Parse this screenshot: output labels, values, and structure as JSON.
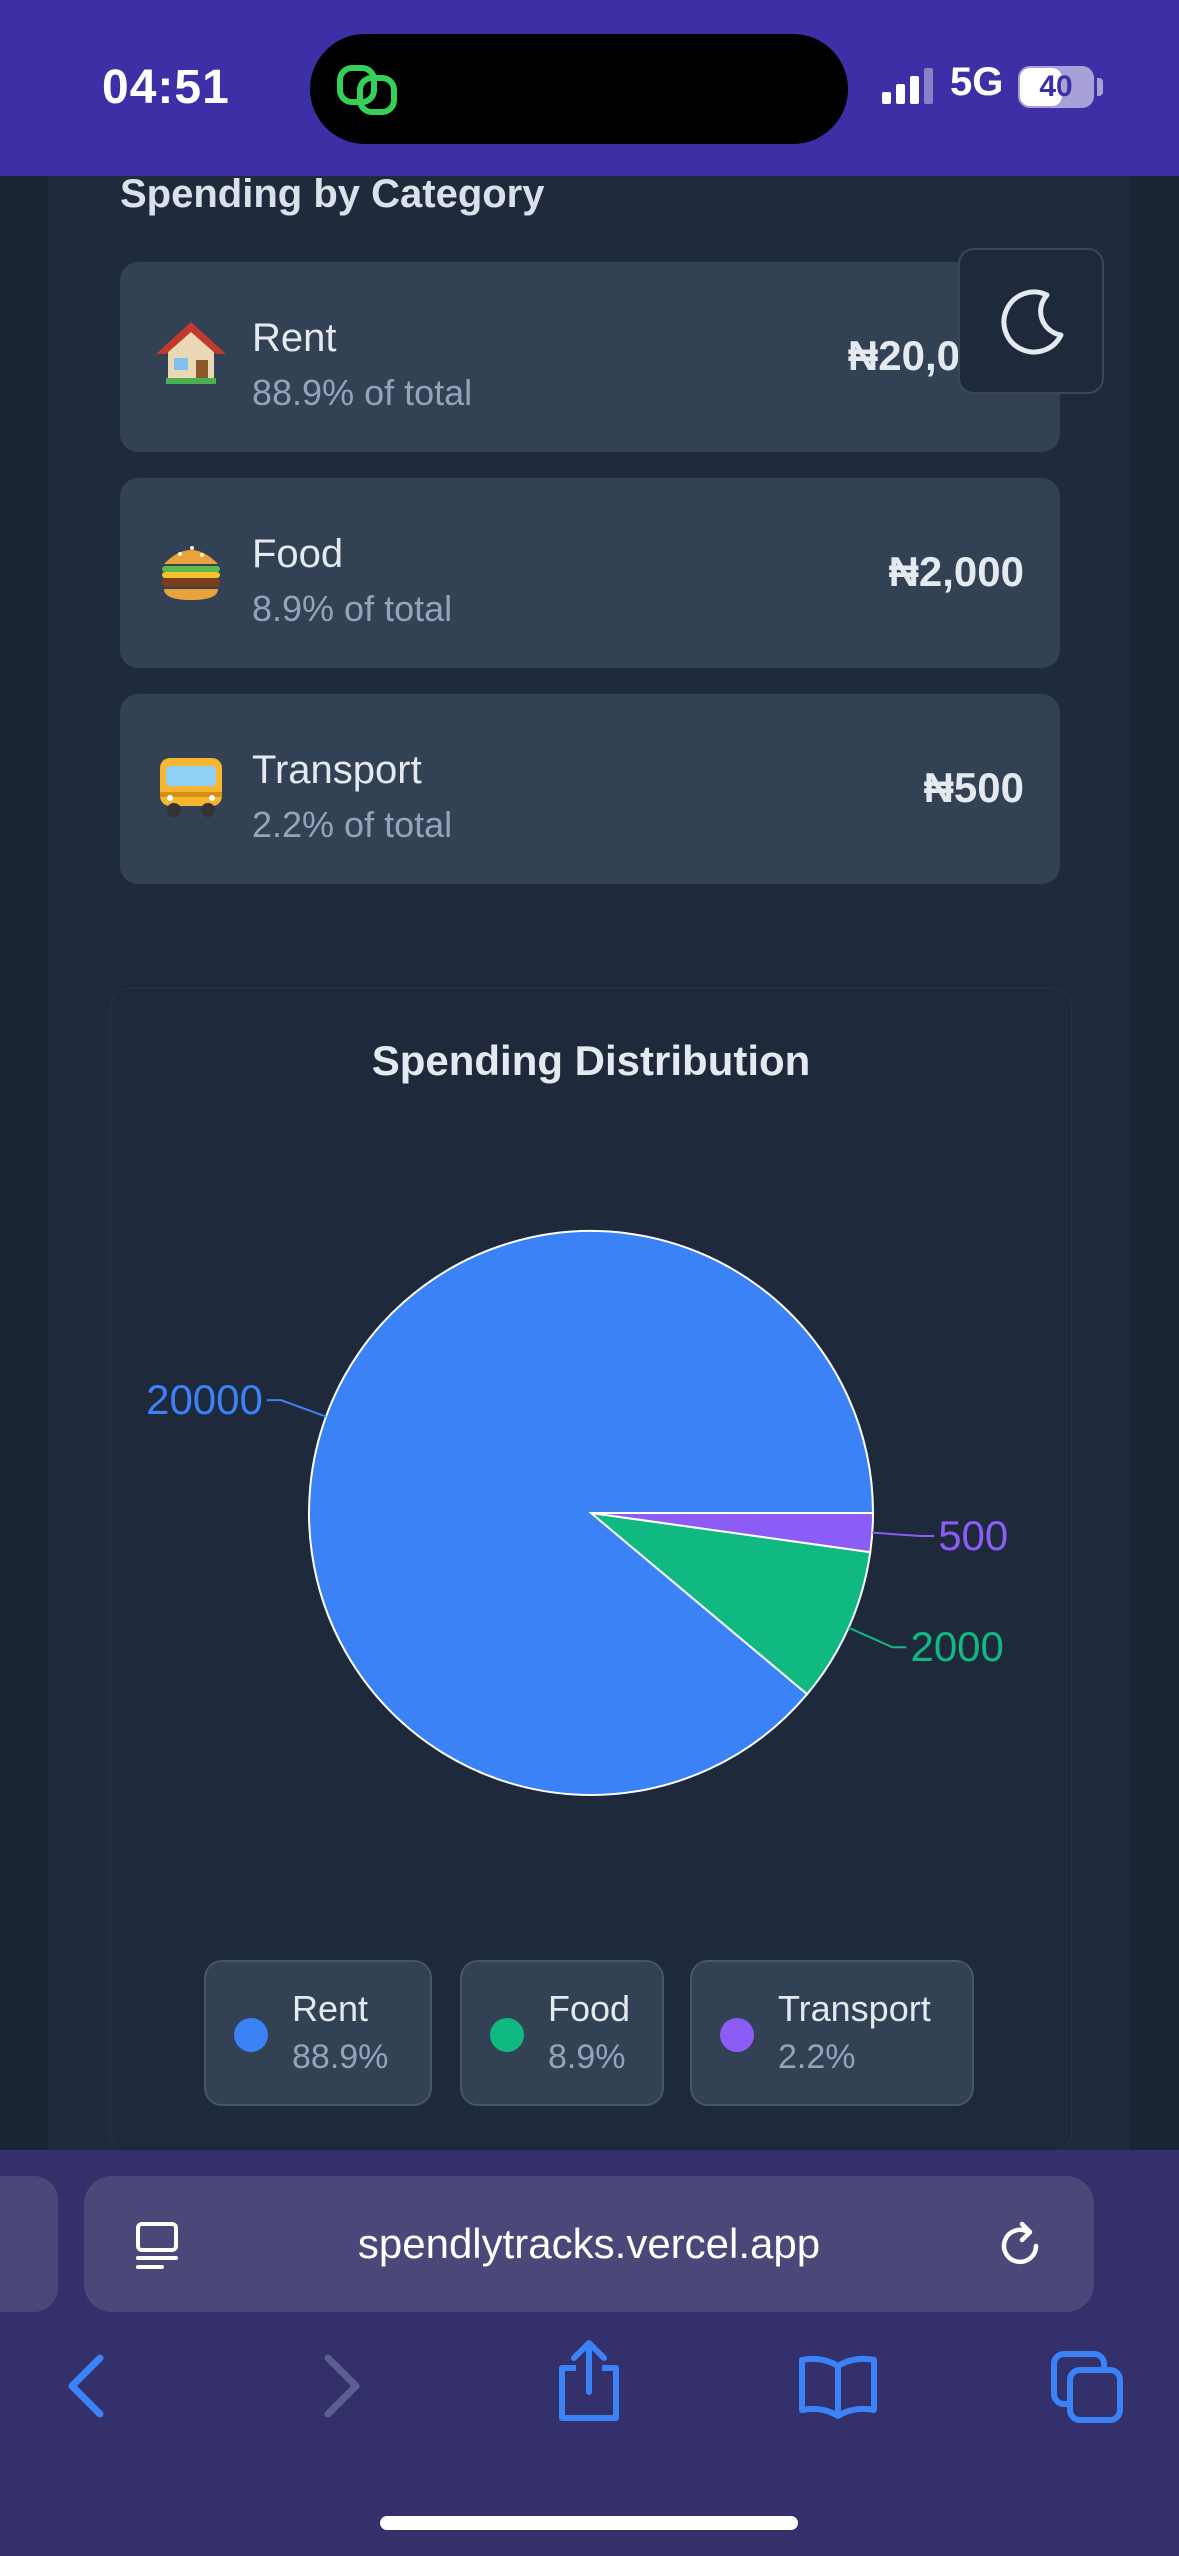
{
  "status_bar": {
    "time": "04:51",
    "network": "5G",
    "battery": "40"
  },
  "spending": {
    "title": "Spending by Category",
    "categories": [
      {
        "name": "Rent",
        "pct_label": "88.9% of total",
        "amount": "₦20,0",
        "emoji": "house-emoji"
      },
      {
        "name": "Food",
        "pct_label": "8.9% of total",
        "amount": "₦2,000",
        "emoji": "burger-emoji"
      },
      {
        "name": "Transport",
        "pct_label": "2.2% of total",
        "amount": "₦500",
        "emoji": "bus-emoji"
      }
    ]
  },
  "theme_toggle": {
    "icon": "moon-icon"
  },
  "chart_data": {
    "type": "pie",
    "title": "Spending Distribution",
    "categories": [
      "Rent",
      "Food",
      "Transport"
    ],
    "values": [
      20000,
      2000,
      500
    ],
    "data_labels": [
      "20000",
      "2000",
      "500"
    ],
    "colors": [
      "#3b82f6",
      "#10b981",
      "#8b5cf6"
    ],
    "legend": [
      {
        "name": "Rent",
        "pct": "88.9%"
      },
      {
        "name": "Food",
        "pct": "8.9%"
      },
      {
        "name": "Transport",
        "pct": "2.2%"
      }
    ]
  },
  "browser": {
    "url": "spendlytracks.vercel.app"
  }
}
